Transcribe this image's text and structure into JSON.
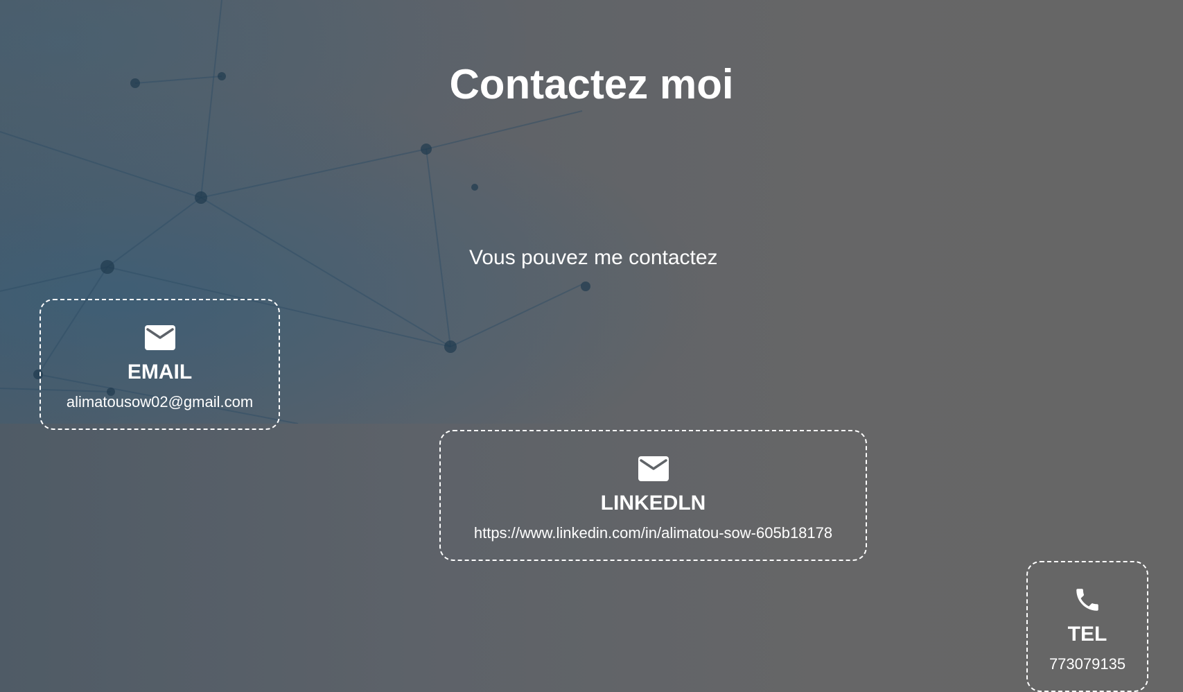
{
  "section": {
    "title": "Contactez moi",
    "subtitle": "Vous pouvez me contactez"
  },
  "contacts": [
    {
      "icon": "envelope-icon",
      "label": "EMAIL",
      "value": "alimatousow02@gmail.com"
    },
    {
      "icon": "envelope-icon",
      "label": "LINKEDLN",
      "value": "https://www.linkedin.com/in/alimatou-sow-605b18178"
    },
    {
      "icon": "phone-icon",
      "label": "TEL",
      "value": "773079135"
    }
  ],
  "colors": {
    "text": "#ffffff",
    "background": "#666666",
    "background_tint": "#3f5a70"
  }
}
